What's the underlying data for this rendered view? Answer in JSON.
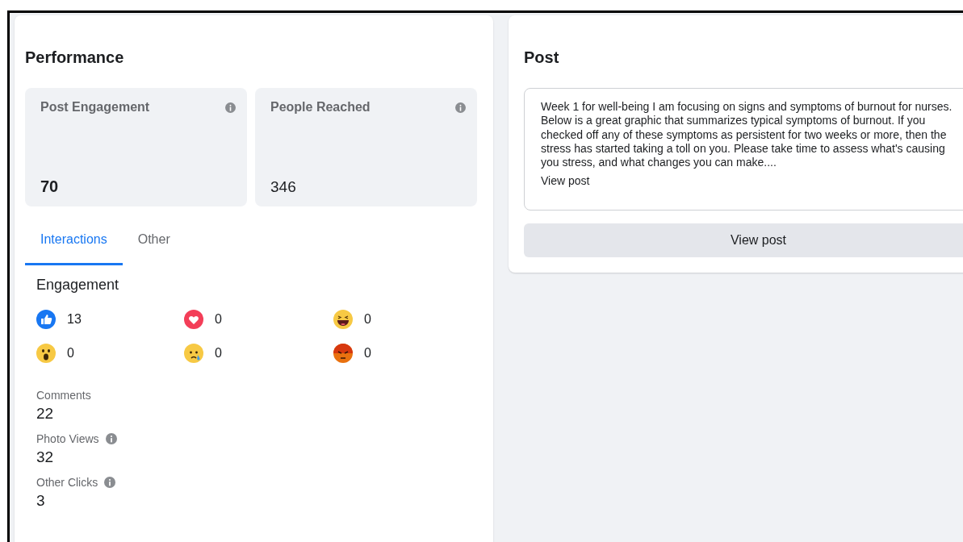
{
  "performance": {
    "title": "Performance",
    "summary_cards": [
      {
        "label": "Post Engagement",
        "value": "70",
        "info": true,
        "bold": true
      },
      {
        "label": "People Reached",
        "value": "346",
        "info": true,
        "bold": false
      }
    ],
    "tabs": [
      {
        "label": "Interactions",
        "selected": true
      },
      {
        "label": "Other",
        "selected": false
      }
    ],
    "engagement": {
      "title": "Engagement",
      "reactions": [
        {
          "kind": "like",
          "count": "13"
        },
        {
          "kind": "love",
          "count": "0"
        },
        {
          "kind": "haha",
          "count": "0"
        },
        {
          "kind": "wow",
          "count": "0"
        },
        {
          "kind": "sad",
          "count": "0"
        },
        {
          "kind": "angry",
          "count": "0"
        }
      ]
    },
    "stats": [
      {
        "label": "Comments",
        "value": "22",
        "info": false
      },
      {
        "label": "Photo Views",
        "value": "32",
        "info": true
      },
      {
        "label": "Other Clicks",
        "value": "3",
        "info": true
      }
    ]
  },
  "post": {
    "title": "Post",
    "text": "Week 1 for well-being I am focusing on signs and symptoms of burnout for nurses. Below is a great graphic that summarizes typical symptoms of burnout. If you checked off any of these symptoms as persistent for two weeks or more, then the stress has started taking a toll on you. Please take time to assess what's causing you stress, and what changes you can make....",
    "link": "View post",
    "button": "View post"
  }
}
